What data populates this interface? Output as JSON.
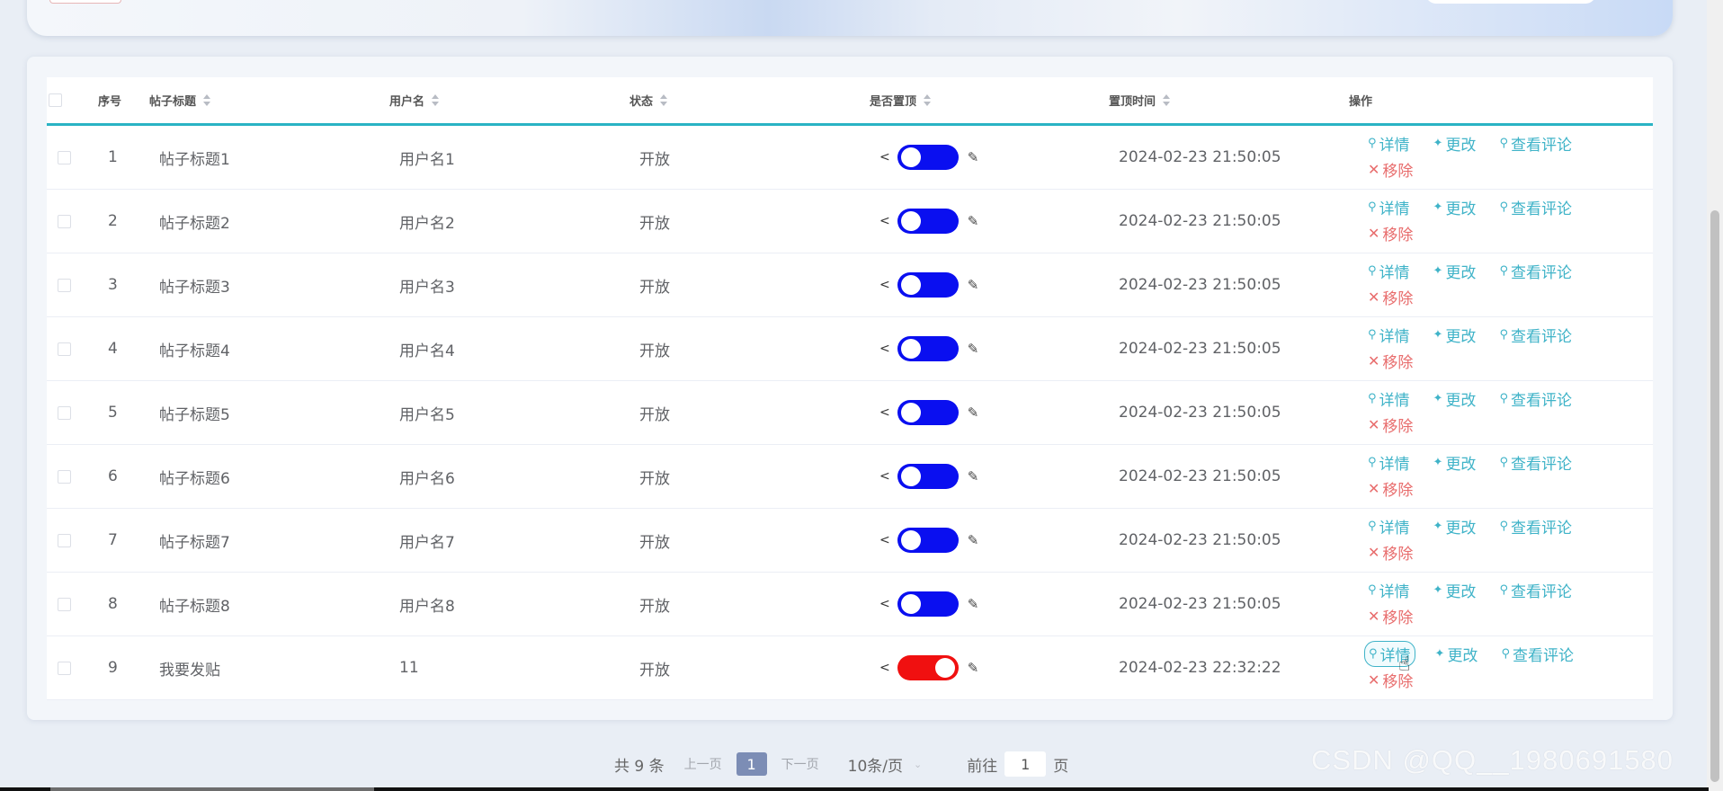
{
  "table": {
    "headers": {
      "index": "序号",
      "title": "帖子标题",
      "username": "用户名",
      "status": "状态",
      "is_top": "是否置顶",
      "top_time": "置顶时间",
      "actions": "操作"
    },
    "rows": [
      {
        "index": "1",
        "title": "帖子标题1",
        "username": "用户名1",
        "status": "开放",
        "is_top": false,
        "top_time": "2024-02-23 21:50:05"
      },
      {
        "index": "2",
        "title": "帖子标题2",
        "username": "用户名2",
        "status": "开放",
        "is_top": false,
        "top_time": "2024-02-23 21:50:05"
      },
      {
        "index": "3",
        "title": "帖子标题3",
        "username": "用户名3",
        "status": "开放",
        "is_top": false,
        "top_time": "2024-02-23 21:50:05"
      },
      {
        "index": "4",
        "title": "帖子标题4",
        "username": "用户名4",
        "status": "开放",
        "is_top": false,
        "top_time": "2024-02-23 21:50:05"
      },
      {
        "index": "5",
        "title": "帖子标题5",
        "username": "用户名5",
        "status": "开放",
        "is_top": false,
        "top_time": "2024-02-23 21:50:05"
      },
      {
        "index": "6",
        "title": "帖子标题6",
        "username": "用户名6",
        "status": "开放",
        "is_top": false,
        "top_time": "2024-02-23 21:50:05"
      },
      {
        "index": "7",
        "title": "帖子标题7",
        "username": "用户名7",
        "status": "开放",
        "is_top": false,
        "top_time": "2024-02-23 21:50:05"
      },
      {
        "index": "8",
        "title": "帖子标题8",
        "username": "用户名8",
        "status": "开放",
        "is_top": false,
        "top_time": "2024-02-23 21:50:05"
      },
      {
        "index": "9",
        "title": "我要发贴",
        "username": "11",
        "status": "开放",
        "is_top": true,
        "top_time": "2024-02-23 22:32:22"
      }
    ],
    "actions": {
      "detail": "详情",
      "edit": "更改",
      "comments": "查看评论",
      "delete": "移除"
    },
    "toggle_colors": {
      "off": "#0a0ff0",
      "on": "#f01010"
    }
  },
  "pagination": {
    "total": "共 9 条",
    "prev": "上一页",
    "current_page": "1",
    "next": "下一页",
    "page_size": "10条/页",
    "goto_label": "前往",
    "goto_value": "1",
    "goto_suffix": "页"
  },
  "watermark": "CSDN @QQ__1980691580",
  "colors": {
    "accent": "#3fb3c8",
    "danger": "#e86d6d",
    "pager_active": "#7c8db5"
  }
}
